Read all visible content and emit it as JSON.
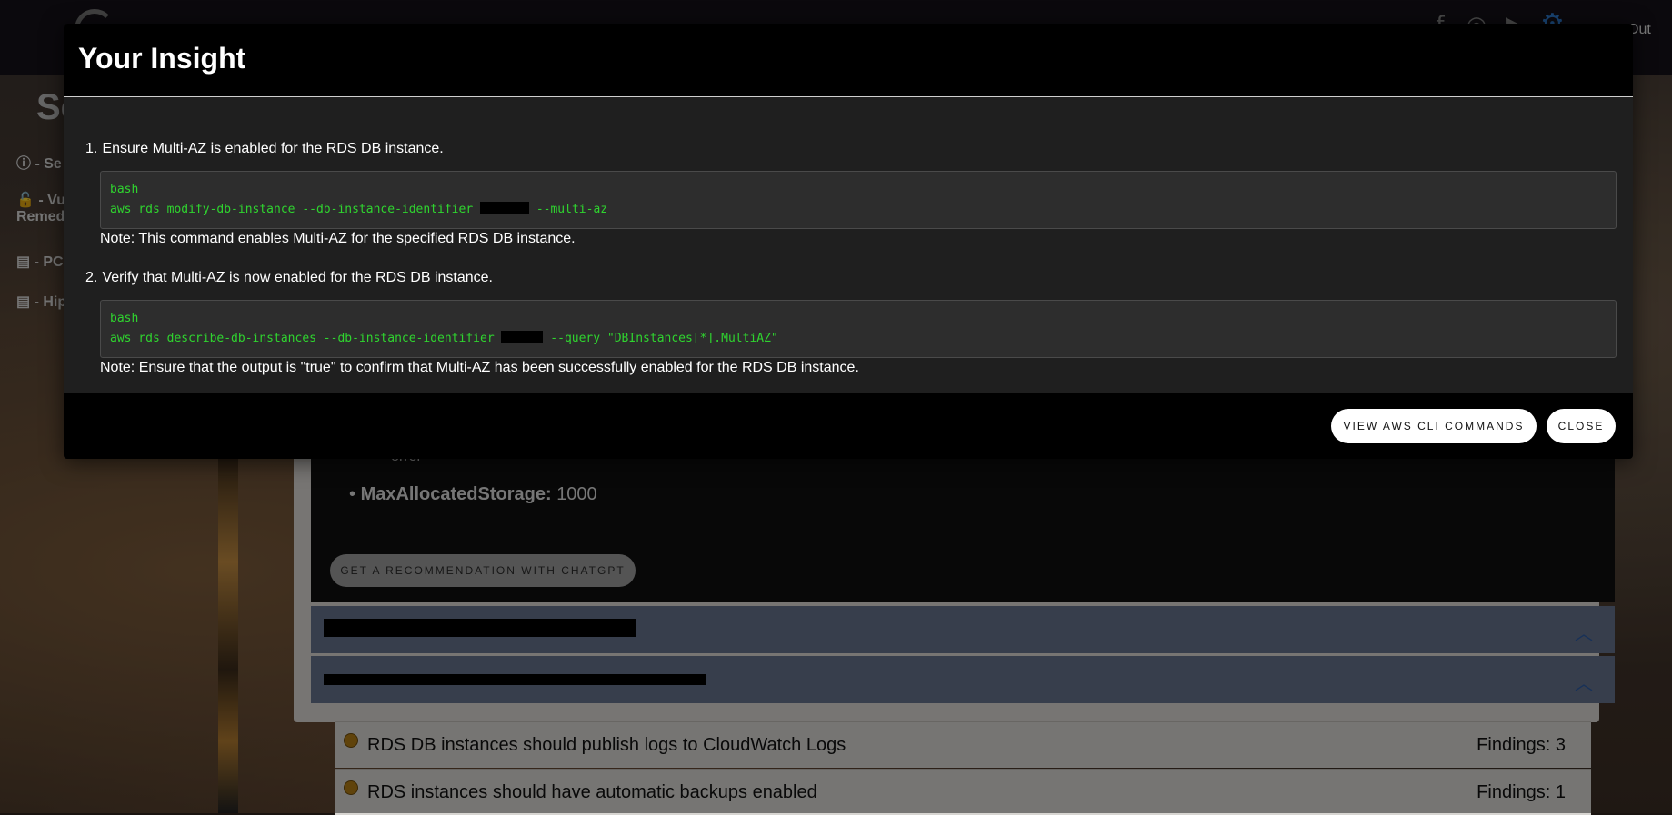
{
  "topbar": {
    "logout_label": "Out",
    "icons": [
      "facebook-icon",
      "instagram-icon",
      "youtube-icon",
      "gear-icon"
    ]
  },
  "sidebar": {
    "title": "Se",
    "items": [
      {
        "icon": "info-icon",
        "label": "- Se"
      },
      {
        "icon": "lock-icon",
        "label": "- Vu",
        "label2": "Remed"
      },
      {
        "icon": "document-icon",
        "label": "- PCI"
      },
      {
        "icon": "document-icon",
        "label": "- Hip"
      }
    ]
  },
  "background": {
    "bullet_partial": "error",
    "max_storage_label": "MaxAllocatedStorage:",
    "max_storage_value": "1000",
    "recommend_button": "GET A RECOMMENDATION WITH CHATGPT",
    "findings": [
      {
        "text": "RDS DB instances should publish logs to CloudWatch Logs",
        "count": "Findings: 3"
      },
      {
        "text": "RDS instances should have automatic backups enabled",
        "count": "Findings: 1"
      }
    ]
  },
  "modal": {
    "title": "Your Insight",
    "steps": [
      {
        "number": "1.",
        "text": "Ensure Multi-AZ is enabled for the RDS DB instance.",
        "code_lang": "bash",
        "code_before": "aws rds modify-db-instance --db-instance-identifier ",
        "code_after": " --multi-az",
        "note": "Note: This command enables Multi-AZ for the specified RDS DB instance."
      },
      {
        "number": "2.",
        "text": "Verify that Multi-AZ is now enabled for the RDS DB instance.",
        "code_lang": "bash",
        "code_before": "aws rds describe-db-instances --db-instance-identifier ",
        "code_after": " --query \"DBInstances[*].MultiAZ\"",
        "note": "Note: Ensure that the output is \"true\" to confirm that Multi-AZ has been successfully enabled for the RDS DB instance."
      }
    ],
    "buttons": {
      "view_cli": "VIEW AWS CLI COMMANDS",
      "close": "CLOSE"
    }
  },
  "colors": {
    "code_text": "#2fd42f",
    "modal_header": "#000000",
    "modal_body": "#1f1f1f",
    "accordion": "#64718a",
    "finding_dot": "#b07a14"
  }
}
